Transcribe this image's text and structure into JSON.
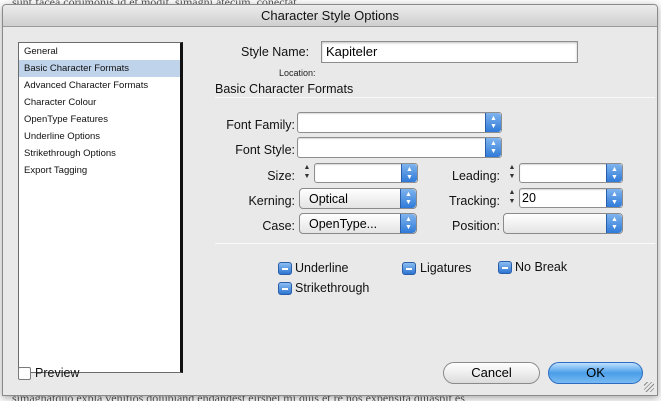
{
  "background_text": {
    "top": "sunt facea corumonis id et modit, simagni atecum, conectat.",
    "bottom": "simagnatquo expla venitios dolupiand endandest eirspel mi quis et re nos expensita quiaspit es"
  },
  "window": {
    "title": "Character Style Options"
  },
  "sidebar": {
    "items": [
      {
        "label": "General",
        "selected": false
      },
      {
        "label": "Basic Character Formats",
        "selected": true
      },
      {
        "label": "Advanced Character Formats",
        "selected": false
      },
      {
        "label": "Character Colour",
        "selected": false
      },
      {
        "label": "OpenType Features",
        "selected": false
      },
      {
        "label": "Underline Options",
        "selected": false
      },
      {
        "label": "Strikethrough Options",
        "selected": false
      },
      {
        "label": "Export Tagging",
        "selected": false
      }
    ]
  },
  "style_name": {
    "label": "Style Name:",
    "value": "Kapiteler"
  },
  "location": {
    "label": "Location:"
  },
  "section": {
    "title": "Basic Character Formats"
  },
  "fields": {
    "font_family": {
      "label": "Font Family:",
      "value": ""
    },
    "font_style": {
      "label": "Font Style:",
      "value": ""
    },
    "size": {
      "label": "Size:",
      "value": ""
    },
    "leading": {
      "label": "Leading:",
      "value": ""
    },
    "kerning": {
      "label": "Kerning:",
      "value": "Optical"
    },
    "tracking": {
      "label": "Tracking:",
      "value": "20"
    },
    "case": {
      "label": "Case:",
      "value": "OpenType..."
    },
    "position": {
      "label": "Position:",
      "value": ""
    }
  },
  "toggles": {
    "underline": "Underline",
    "ligatures": "Ligatures",
    "no_break": "No Break",
    "strikethrough": "Strikethrough"
  },
  "preview": {
    "label": "Preview",
    "checked": false
  },
  "buttons": {
    "cancel": "Cancel",
    "ok": "OK"
  },
  "icons": {
    "combo_arrow": "up-down-arrows-icon",
    "toggle": "indeterminate-checkbox-icon",
    "stepper": "stepper-arrows-icon"
  },
  "colors": {
    "accent": "#3a86e0",
    "selection": "#bfd3ea"
  }
}
